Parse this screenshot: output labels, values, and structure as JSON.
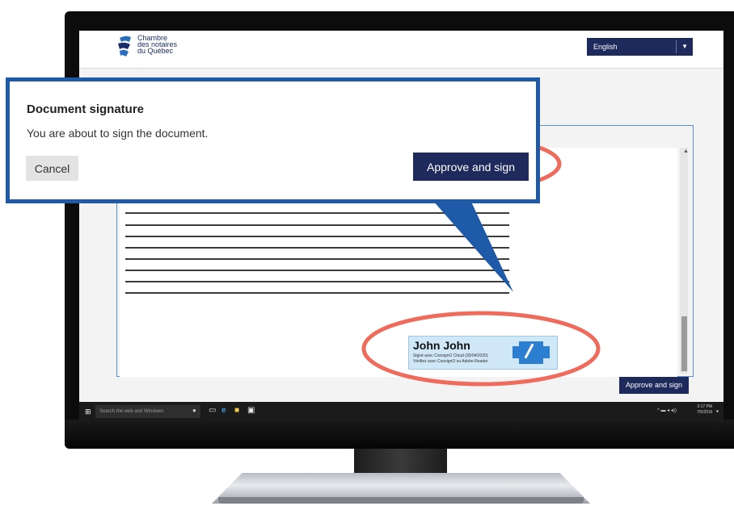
{
  "header": {
    "logo_lines": [
      "Chambre",
      "des notaires",
      "du Québec"
    ],
    "language": {
      "selected": "English"
    }
  },
  "dialog": {
    "title": "Document signature",
    "message": "You are about to sign the document.",
    "cancel_label": "Cancel",
    "approve_label": "Approve and sign"
  },
  "document": {
    "signature": {
      "name": "John John",
      "line1": "Signé avec ConsignO Cloud (30/04/2020)",
      "line2": "Vérifiez avec ConsignO ou Adobe Reader."
    },
    "approve_label": "Approve and sign"
  },
  "taskbar": {
    "search_placeholder": "Search the web and Windows",
    "clock_time": "3:17 PM",
    "clock_date": "7/5/2016"
  },
  "colors": {
    "brand_navy": "#1e2a5c",
    "callout_blue": "#1f5aa8",
    "highlight_red": "#ef6b5b"
  }
}
